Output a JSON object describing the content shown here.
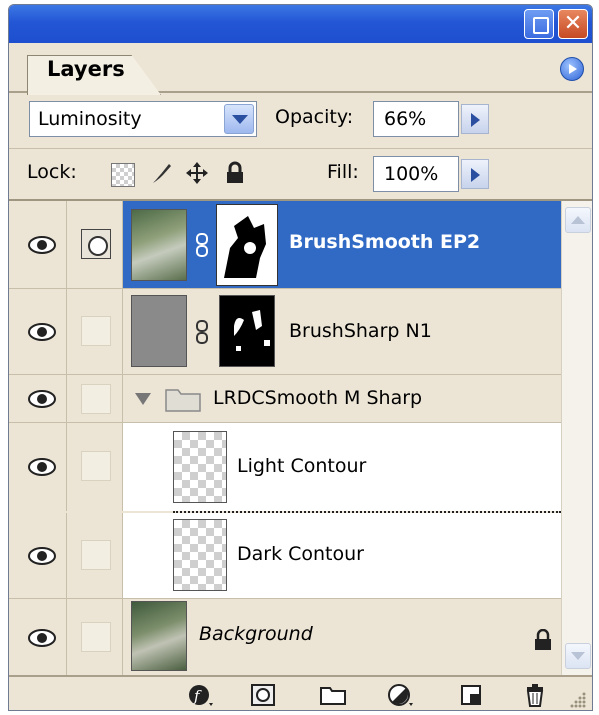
{
  "panel": {
    "tab_label": "Layers",
    "blend_mode": "Luminosity",
    "opacity_label": "Opacity:",
    "opacity_value": "66%",
    "lock_label": "Lock:",
    "fill_label": "Fill:",
    "fill_value": "100%"
  },
  "layers": [
    {
      "name": "BrushSmooth EP2",
      "selected": true,
      "has_mask": true,
      "linked_mask_icon": true
    },
    {
      "name": "BrushSharp N1",
      "selected": false,
      "has_mask": true
    },
    {
      "name": "LRDCSmooth M Sharp",
      "type": "group",
      "expanded": true
    },
    {
      "name": "Light Contour",
      "indent": true
    },
    {
      "name": "Dark Contour",
      "indent": true,
      "clipped": true
    },
    {
      "name": "Background",
      "italic": true,
      "locked": true
    }
  ],
  "colors": {
    "selection": "#316ac5",
    "panel_bg": "#ece5d6",
    "titlebar": "#2356d5"
  },
  "icons": [
    "eye-icon",
    "layer-mask-icon",
    "chain-link-icon",
    "folder-icon",
    "lock-icon",
    "layer-style-icon",
    "add-mask-icon",
    "new-group-icon",
    "adjustment-layer-icon",
    "new-layer-icon",
    "trash-icon"
  ]
}
